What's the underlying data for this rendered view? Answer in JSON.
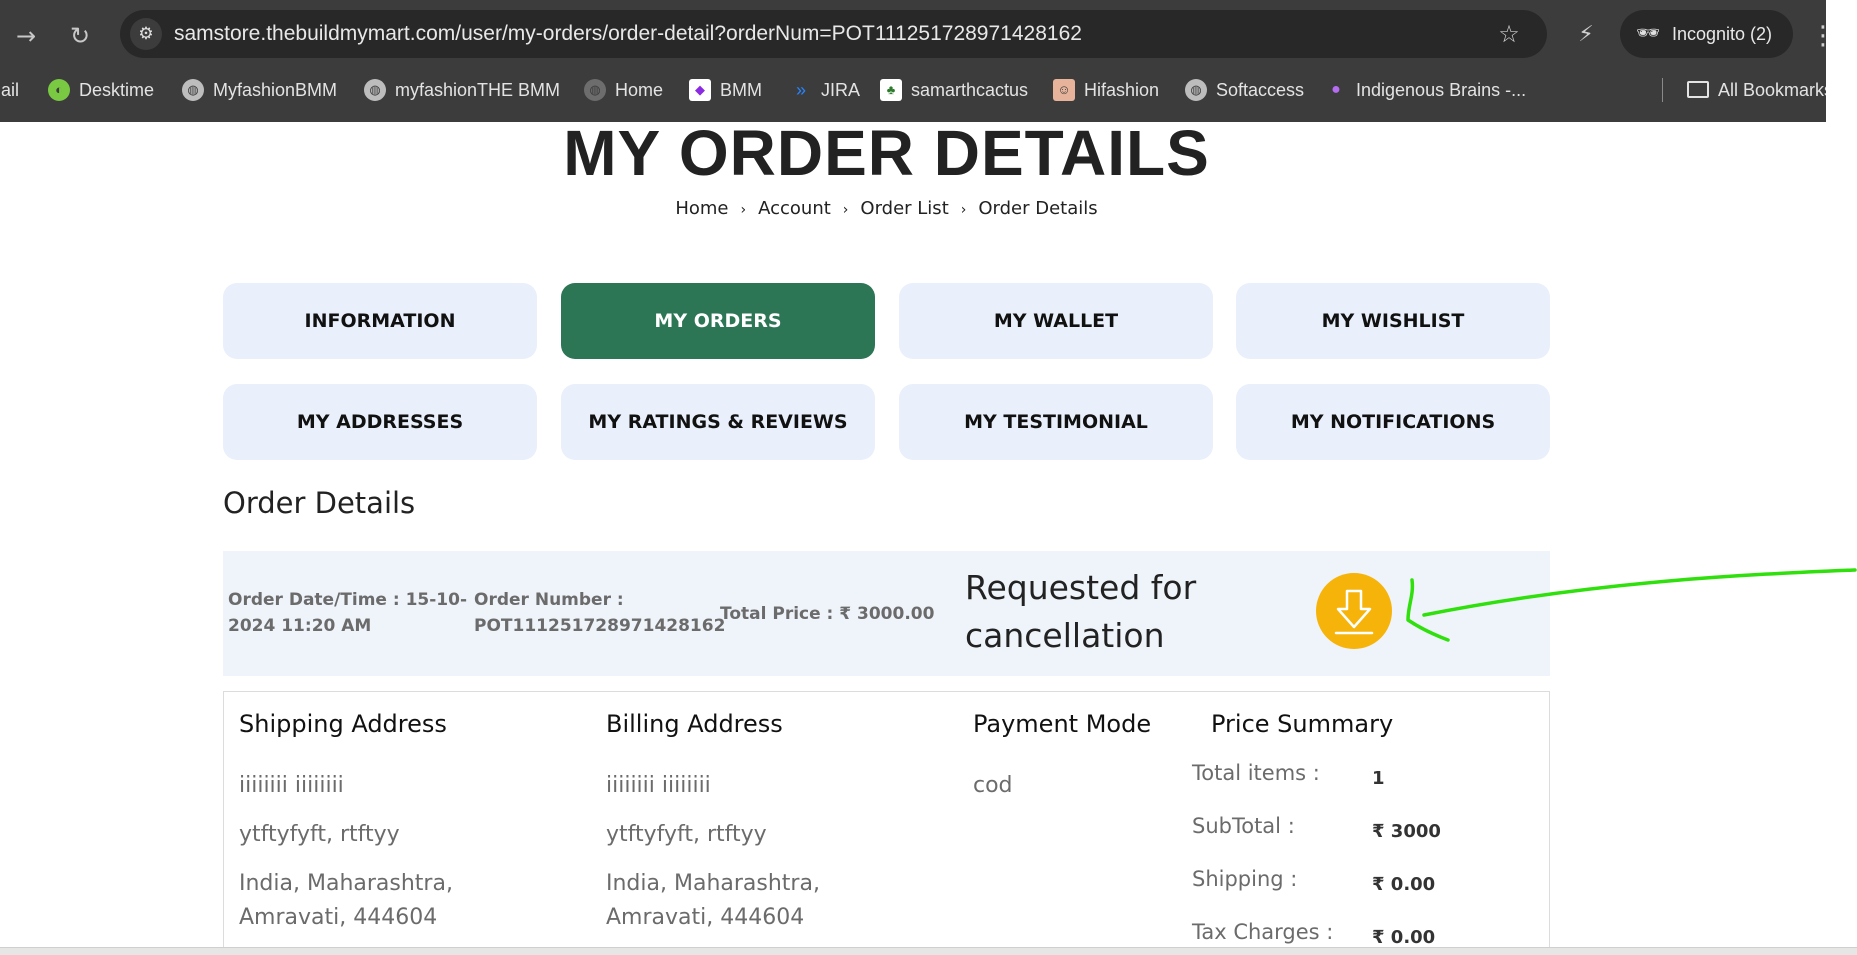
{
  "browser": {
    "url": "samstore.thebuildmymart.com/user/my-orders/order-detail?orderNum=POT111251728971428162",
    "incognito_label": "Incognito (2)",
    "bookmarks": [
      {
        "label": "Mail",
        "icon": "mail-icon"
      },
      {
        "label": "Desktime",
        "icon": "desktime-icon"
      },
      {
        "label": "MyfashionBMM",
        "icon": "globe-icon"
      },
      {
        "label": "myfashionTHE BMM",
        "icon": "globe-icon"
      },
      {
        "label": "Home",
        "icon": "globe-icon"
      },
      {
        "label": "BMM",
        "icon": "bmm-icon"
      },
      {
        "label": "JIRA",
        "icon": "jira-icon"
      },
      {
        "label": "samarthcactus",
        "icon": "cactus-icon"
      },
      {
        "label": "Hifashion",
        "icon": "hifashion-icon"
      },
      {
        "label": "Softaccess",
        "icon": "globe-icon"
      },
      {
        "label": "Indigenous Brains -...",
        "icon": "indigenous-icon"
      }
    ],
    "all_bookmarks_label": "All Bookmarks"
  },
  "page": {
    "title": "MY ORDER DETAILS",
    "breadcrumb": [
      "Home",
      "Account",
      "Order List",
      "Order Details"
    ]
  },
  "tabs": [
    {
      "label": "INFORMATION",
      "active": false
    },
    {
      "label": "MY ORDERS",
      "active": true
    },
    {
      "label": "MY WALLET",
      "active": false
    },
    {
      "label": "MY WISHLIST",
      "active": false
    },
    {
      "label": "MY ADDRESSES",
      "active": false
    },
    {
      "label": "MY RATINGS & REVIEWS",
      "active": false
    },
    {
      "label": "MY TESTIMONIAL",
      "active": false
    },
    {
      "label": "MY NOTIFICATIONS",
      "active": false
    }
  ],
  "order": {
    "section_title": "Order Details",
    "date_line1": "Order Date/Time : 15-10-",
    "date_line2": "2024 11:20 AM",
    "number_label": "Order Number :",
    "number_value": "POT111251728971428162",
    "total_price": "Total Price : ₹ 3000.00",
    "status_line1": "Requested for",
    "status_line2": "cancellation"
  },
  "shipping": {
    "title": "Shipping Address",
    "name": "iiiiiiii iiiiiiii",
    "street": "ytftyfyft, rtftyy",
    "region_line1": "India, Maharashtra,",
    "region_line2": "Amravati, 444604"
  },
  "billing": {
    "title": "Billing Address",
    "name": "iiiiiiii iiiiiiii",
    "street": "ytftyfyft, rtftyy",
    "region_line1": "India, Maharashtra,",
    "region_line2": "Amravati, 444604"
  },
  "payment": {
    "title": "Payment Mode",
    "mode": "cod"
  },
  "price_summary": {
    "title": "Price Summary",
    "rows": [
      {
        "label": "Total items :",
        "value": "1"
      },
      {
        "label": "SubTotal :",
        "value": "₹ 3000"
      },
      {
        "label": "Shipping :",
        "value": "₹ 0.00"
      },
      {
        "label": "Tax Charges :",
        "value": "₹ 0.00"
      }
    ]
  },
  "colors": {
    "active_tab": "#2d7655",
    "inactive_tab": "#e9f0fb",
    "download_button": "#f6b30a",
    "annotation_arrow": "#2fe00c"
  }
}
